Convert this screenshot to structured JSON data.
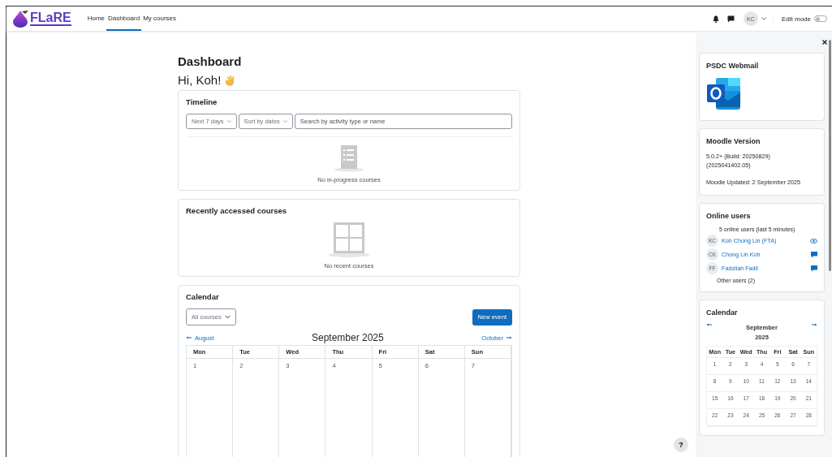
{
  "header": {
    "logo_text": "FLaRE",
    "nav": [
      {
        "label": "Home",
        "selected": false
      },
      {
        "label": "Dashboard",
        "selected": true
      },
      {
        "label": "My courses",
        "selected": false
      }
    ],
    "avatar": "KC",
    "edit_mode": {
      "label": "Edit mode",
      "on": false
    }
  },
  "page": {
    "title": "Dashboard",
    "greeting": "Hi, Koh!"
  },
  "timeline": {
    "title": "Timeline",
    "filters": [
      "Next 7 days",
      "Sort by dates"
    ],
    "search": {
      "placeholder": "Search by activity type or name"
    },
    "empty": "No in-progress courses"
  },
  "recent": {
    "title": "Recently accessed courses",
    "empty": "No recent courses"
  },
  "calendar": {
    "title": "Calendar",
    "course_filter": "All courses",
    "new_button": "New event",
    "prev": "August",
    "next": "October",
    "month": "September 2025",
    "weekdays": [
      "Mon",
      "Tue",
      "Wed",
      "Thu",
      "Fri",
      "Sat",
      "Sun"
    ],
    "days": [
      "1",
      "2",
      "3",
      "4",
      "5",
      "6",
      "7"
    ]
  },
  "drawer": {
    "webmail": {
      "title": "PSDC Webmail"
    },
    "version": {
      "title": "Moodle Version",
      "lines": [
        "5.0.2+ (Build: 20250829)",
        "(2025041402.05)"
      ],
      "updated": "Moodle Updated: 2 September 2025"
    },
    "online": {
      "title": "Online users",
      "summary": "5 online users (last 5 minutes)",
      "users": [
        {
          "initials": "KC",
          "name": "Koh Chong Lin (FTA)",
          "kind": "view"
        },
        {
          "initials": "CK",
          "name": "Chong Lin Koh",
          "kind": "message"
        },
        {
          "initials": "FF",
          "name": "Fadzilah Fadil",
          "kind": "message"
        }
      ],
      "other": "Other users (2)"
    },
    "mini_calendar": {
      "title": "Calendar",
      "month": "September 2025",
      "weekdays": [
        "Mon",
        "Tue",
        "Wed",
        "Thu",
        "Fri",
        "Sat",
        "Sun"
      ],
      "weeks": [
        [
          "1",
          "2",
          "3",
          "4",
          "5",
          "6",
          "7"
        ],
        [
          "8",
          "9",
          "10",
          "11",
          "12",
          "13",
          "14"
        ],
        [
          "15",
          "16",
          "17",
          "18",
          "19",
          "20",
          "21"
        ],
        [
          "22",
          "23",
          "24",
          "25",
          "26",
          "27",
          "28"
        ]
      ]
    }
  },
  "help": "?"
}
